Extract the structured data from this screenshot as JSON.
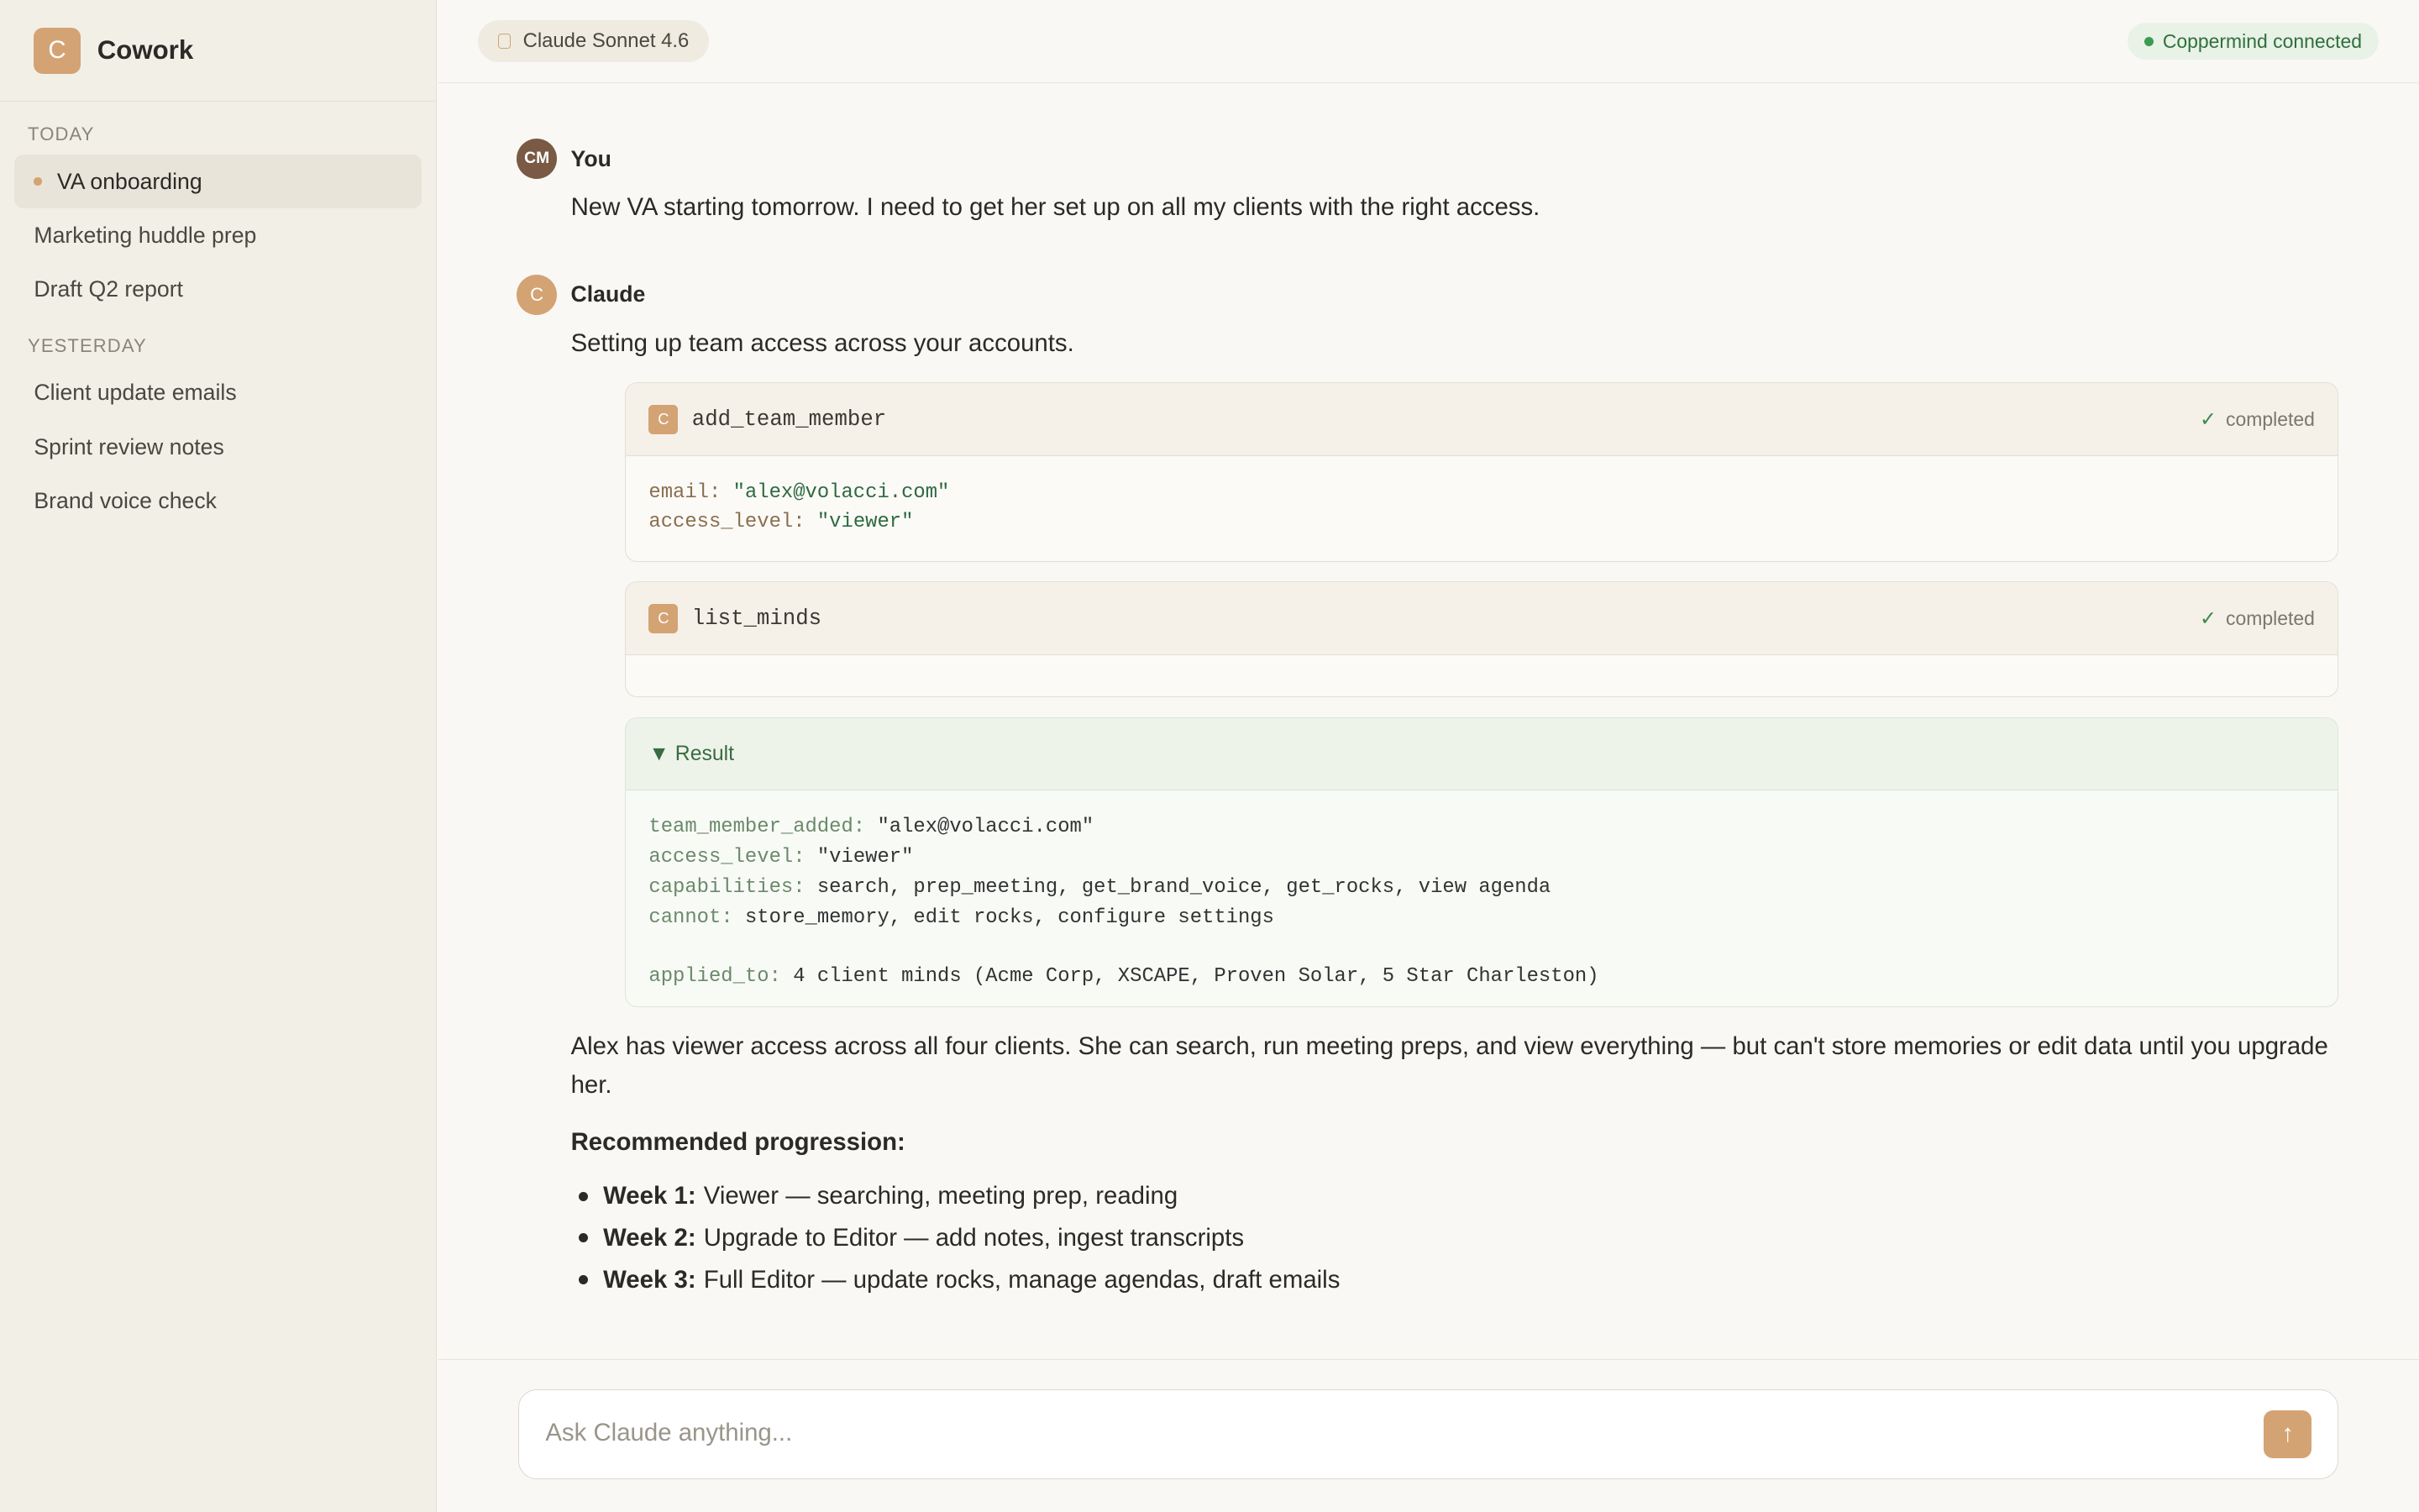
{
  "app": {
    "logo_letter": "C",
    "name": "Cowork"
  },
  "sidebar": {
    "today_label": "TODAY",
    "today": [
      "VA onboarding",
      "Marketing huddle prep",
      "Draft Q2 report"
    ],
    "yesterday_label": "YESTERDAY",
    "yesterday": [
      "Client update emails",
      "Sprint review notes",
      "Brand voice check"
    ]
  },
  "topbar": {
    "model": "Claude Sonnet 4.6",
    "status": "Coppermind connected"
  },
  "conversation": {
    "user": {
      "initials": "CM",
      "name": "You",
      "text": "New VA starting tomorrow. I need to get her set up on all my clients with the right access."
    },
    "claude": {
      "initial": "C",
      "name": "Claude",
      "intro": "Setting up team access across your accounts.",
      "tool1": {
        "icon": "C",
        "name": "add_team_member",
        "status": "completed",
        "args": [
          {
            "key": "email",
            "value": "\"alex@volacci.com\""
          },
          {
            "key": "access_level",
            "value": "\"viewer\""
          }
        ]
      },
      "tool2": {
        "icon": "C",
        "name": "list_minds",
        "status": "completed"
      },
      "result": {
        "label": "▼ Result",
        "lines": [
          {
            "key": "team_member_added",
            "value": "\"alex@volacci.com\""
          },
          {
            "key": "access_level",
            "value": "\"viewer\""
          },
          {
            "key": "capabilities",
            "value": "search, prep_meeting, get_brand_voice, get_rocks, view agenda"
          },
          {
            "key": "cannot",
            "value": "store_memory, edit rocks, configure settings"
          },
          {
            "key": "applied_to",
            "value": "4 client minds (Acme Corp, XSCAPE, Proven Solar, 5 Star Charleston)"
          }
        ]
      },
      "summary": "Alex has viewer access across all four clients. She can search, run meeting preps, and view everything — but can't store memories or edit data until you upgrade her.",
      "progression_heading": "Recommended progression:",
      "progression": [
        {
          "week": "Week 1:",
          "text": "Viewer — searching, meeting prep, reading"
        },
        {
          "week": "Week 2:",
          "text": "Upgrade to Editor — add notes, ingest transcripts"
        },
        {
          "week": "Week 3:",
          "text": "Full Editor — update rocks, manage agendas, draft emails"
        }
      ]
    }
  },
  "composer": {
    "placeholder": "Ask Claude anything...",
    "send_icon": "arrow-up-icon"
  },
  "colors": {
    "accent": "#d4a373",
    "sidebar_bg": "#f2efe7",
    "success": "#3d9a52"
  }
}
